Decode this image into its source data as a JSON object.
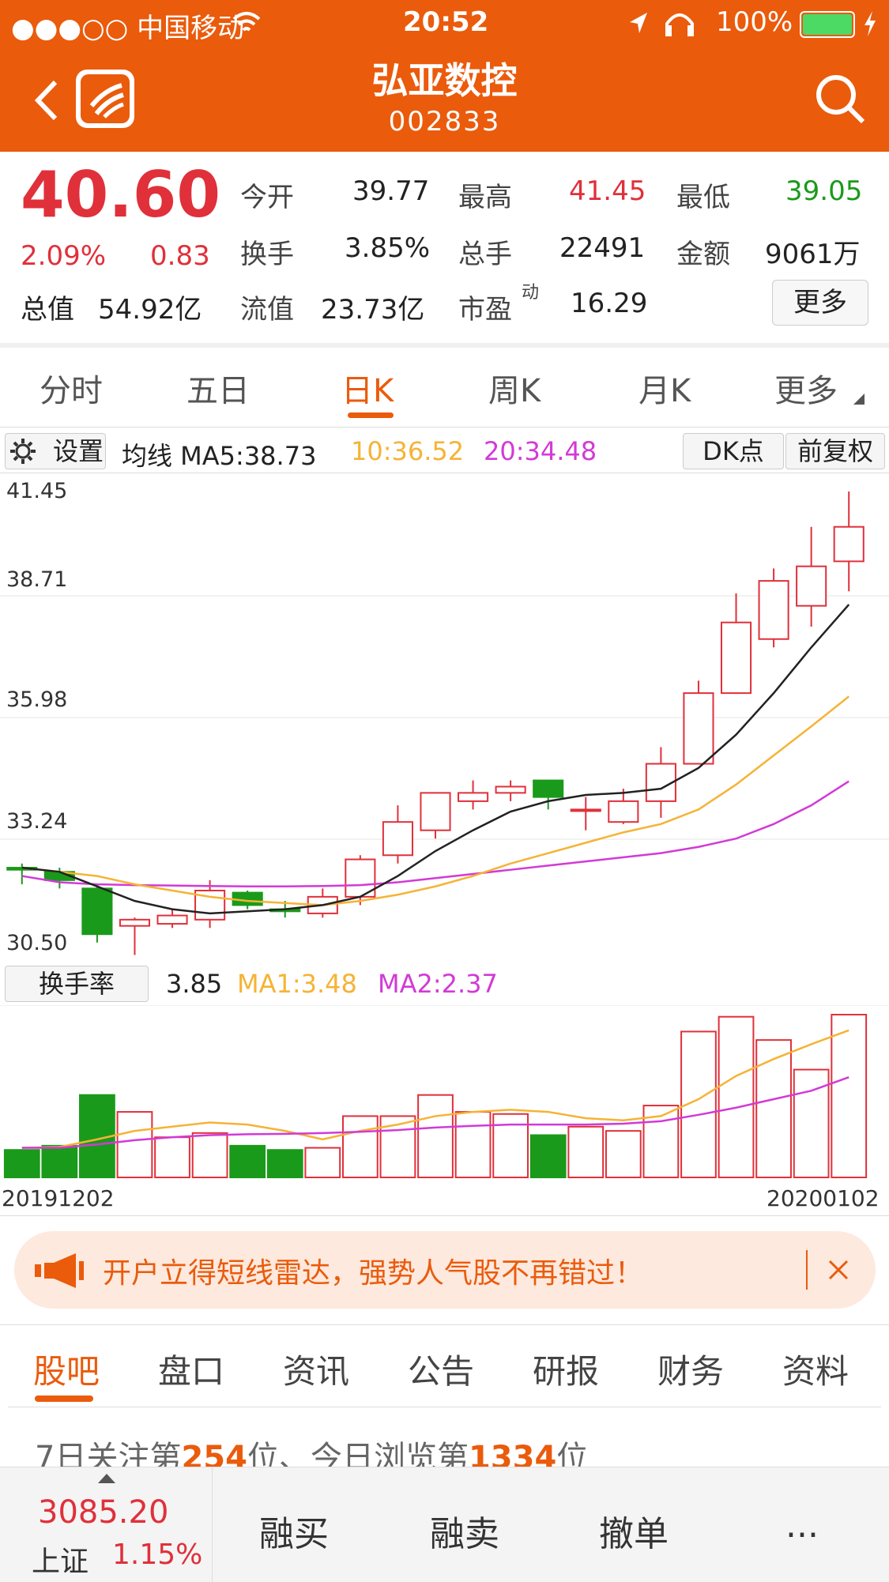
{
  "status_bar": {
    "carrier": "●●●○○ 中国移动",
    "time": "20:52",
    "battery": "100%"
  },
  "header": {
    "title": "弘亚数控",
    "code": "002833",
    "back_icon": "chevron-left-icon",
    "search_icon": "search-icon"
  },
  "quote": {
    "price": "40.60",
    "change_pct": "2.09%",
    "change": "0.83",
    "open_label": "今开",
    "open": "39.77",
    "high_label": "最高",
    "high": "41.45",
    "low_label": "最低",
    "low": "39.05",
    "turnover_label": "换手",
    "turnover": "3.85%",
    "volume_label": "总手",
    "volume": "22491",
    "amount_label": "金额",
    "amount": "9061万",
    "mcap_label": "总值",
    "mcap": "54.92亿",
    "float_label": "流值",
    "float": "23.73亿",
    "pe_label": "市盈",
    "pe_sup": "动",
    "pe": "16.29",
    "more": "更多"
  },
  "tabs": [
    "分时",
    "五日",
    "日K",
    "周K",
    "月K",
    "更多"
  ],
  "active_tab": 2,
  "kline_header": {
    "settings": "设置",
    "ma_label": "均线 MA5:38.73",
    "ma10": "10:36.52",
    "ma20": "20:34.48",
    "dk": "DK点",
    "adjust": "前复权"
  },
  "y_labels": [
    "41.45",
    "38.71",
    "35.98",
    "33.24",
    "30.50"
  ],
  "turnover_header": {
    "label": "换手率",
    "value": "3.85",
    "ma1": "MA1:3.48",
    "ma2": "MA2:2.37"
  },
  "dates": {
    "start": "20191202",
    "end": "20200102"
  },
  "banner": {
    "text": "开户立得短线雷达，强势人气股不再错过！",
    "icon": "megaphone-icon",
    "close_icon": "close-icon"
  },
  "bottom_tabs": [
    "股吧",
    "盘口",
    "资讯",
    "公告",
    "研报",
    "财务",
    "资料"
  ],
  "rank": {
    "prefix": "7日关注第",
    "follow": "254",
    "mid": "位、今日浏览第",
    "browse": "1334",
    "suffix": "位"
  },
  "footer": {
    "index_value": "3085.20",
    "index_name": "上证",
    "index_change": "1.15%",
    "buy": "融买",
    "sell": "融卖",
    "cancel": "撤单",
    "more": "..."
  },
  "colors": {
    "brand": "#ea5b0c",
    "up": "#e0303a",
    "down": "#1a9a1a",
    "ma10": "#f5b335",
    "ma20": "#d23ad6"
  },
  "chart_data": [
    {
      "type": "candlestick",
      "ylim": [
        30.5,
        41.45
      ],
      "candles": [
        {
          "o": 32.4,
          "c": 32.35,
          "h": 32.5,
          "l": 32.0
        },
        {
          "o": 32.3,
          "c": 32.1,
          "h": 32.4,
          "l": 31.9
        },
        {
          "o": 31.9,
          "c": 30.8,
          "h": 32.0,
          "l": 30.6
        },
        {
          "o": 31.0,
          "c": 31.15,
          "h": 31.2,
          "l": 30.3
        },
        {
          "o": 31.05,
          "c": 31.25,
          "h": 31.4,
          "l": 30.95
        },
        {
          "o": 31.15,
          "c": 31.85,
          "h": 32.1,
          "l": 30.95
        },
        {
          "o": 31.8,
          "c": 31.5,
          "h": 31.85,
          "l": 31.4
        },
        {
          "o": 31.4,
          "c": 31.35,
          "h": 31.6,
          "l": 31.2
        },
        {
          "o": 31.3,
          "c": 31.7,
          "h": 31.9,
          "l": 31.2
        },
        {
          "o": 31.7,
          "c": 32.6,
          "h": 32.7,
          "l": 31.5
        },
        {
          "o": 32.7,
          "c": 33.5,
          "h": 33.9,
          "l": 32.5
        },
        {
          "o": 33.3,
          "c": 34.2,
          "h": 34.2,
          "l": 33.1
        },
        {
          "o": 34.0,
          "c": 34.2,
          "h": 34.5,
          "l": 33.8
        },
        {
          "o": 34.2,
          "c": 34.35,
          "h": 34.5,
          "l": 34.0
        },
        {
          "o": 34.5,
          "c": 34.1,
          "h": 34.5,
          "l": 33.8
        },
        {
          "o": 33.8,
          "c": 33.8,
          "h": 34.1,
          "l": 33.3
        },
        {
          "o": 33.5,
          "c": 34.0,
          "h": 34.3,
          "l": 33.45
        },
        {
          "o": 34.0,
          "c": 34.9,
          "h": 35.3,
          "l": 33.6
        },
        {
          "o": 34.9,
          "c": 36.6,
          "h": 36.9,
          "l": 34.9
        },
        {
          "o": 36.6,
          "c": 38.3,
          "h": 39.0,
          "l": 36.6
        },
        {
          "o": 37.9,
          "c": 39.3,
          "h": 39.6,
          "l": 37.7
        },
        {
          "o": 38.7,
          "c": 39.65,
          "h": 40.6,
          "l": 38.2
        },
        {
          "o": 39.77,
          "c": 40.6,
          "h": 41.45,
          "l": 39.05
        }
      ],
      "ma5": [
        32.4,
        32.3,
        31.95,
        31.6,
        31.4,
        31.3,
        31.35,
        31.4,
        31.5,
        31.7,
        32.2,
        32.8,
        33.3,
        33.75,
        34.0,
        34.15,
        34.2,
        34.3,
        34.8,
        35.6,
        36.6,
        37.7,
        38.73
      ],
      "ma10": [
        32.4,
        32.3,
        32.2,
        32.0,
        31.85,
        31.7,
        31.6,
        31.55,
        31.5,
        31.6,
        31.75,
        31.95,
        32.2,
        32.5,
        32.75,
        33.0,
        33.25,
        33.45,
        33.8,
        34.4,
        35.1,
        35.8,
        36.52
      ],
      "ma20": [
        32.2,
        32.05,
        32.0,
        31.98,
        31.97,
        31.96,
        31.95,
        31.95,
        31.96,
        31.98,
        32.05,
        32.15,
        32.25,
        32.35,
        32.45,
        32.55,
        32.65,
        32.75,
        32.9,
        33.1,
        33.45,
        33.9,
        34.48
      ]
    },
    {
      "type": "bar",
      "ylim": [
        0,
        4.0
      ],
      "values": [
        0.65,
        0.75,
        1.95,
        1.55,
        0.95,
        1.05,
        0.75,
        0.65,
        0.7,
        1.45,
        1.45,
        1.95,
        1.55,
        1.5,
        1.0,
        1.2,
        1.1,
        1.7,
        3.45,
        3.8,
        3.25,
        2.55,
        3.85
      ],
      "ma1": [
        0.7,
        0.72,
        0.9,
        1.1,
        1.2,
        1.3,
        1.25,
        1.1,
        0.9,
        1.1,
        1.25,
        1.45,
        1.55,
        1.6,
        1.55,
        1.4,
        1.35,
        1.45,
        1.85,
        2.4,
        2.8,
        3.15,
        3.48
      ],
      "ma2": [
        0.7,
        0.7,
        0.78,
        0.88,
        0.95,
        1.0,
        1.02,
        1.03,
        1.05,
        1.08,
        1.12,
        1.18,
        1.22,
        1.25,
        1.25,
        1.25,
        1.27,
        1.33,
        1.48,
        1.65,
        1.85,
        2.05,
        2.37
      ]
    }
  ]
}
